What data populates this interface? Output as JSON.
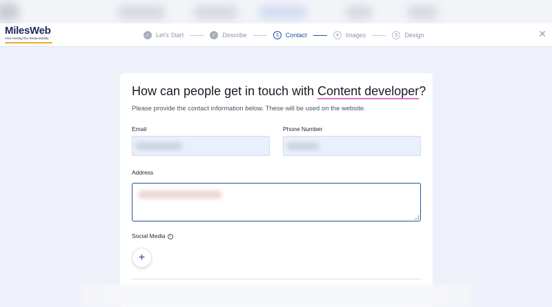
{
  "brand": {
    "name": "MilesWeb",
    "tagline": "Your Hosting Our Responsibility",
    "accent_color": "#f5a623"
  },
  "stepper": {
    "steps": [
      {
        "number": "1",
        "label": "Let's Start",
        "state": "done"
      },
      {
        "number": "2",
        "label": "Describe",
        "state": "done"
      },
      {
        "number": "3",
        "label": "Contact",
        "state": "active"
      },
      {
        "number": "4",
        "label": "Images",
        "state": "todo"
      },
      {
        "number": "5",
        "label": "Design",
        "state": "todo"
      }
    ],
    "active_color": "#1d4f9e"
  },
  "form": {
    "title_prefix": "How can people get in touch with ",
    "title_highlight": "Content developer",
    "title_suffix": "?",
    "subtitle": "Please provide the contact information below. These will be used on the website.",
    "email_label": "Email",
    "phone_label": "Phone Number",
    "address_label": "Address",
    "social_label": "Social Media",
    "add_symbol": "+"
  },
  "icons": {
    "close": "close-icon",
    "info": "info-icon",
    "check": "check-icon",
    "plus": "plus-icon"
  }
}
